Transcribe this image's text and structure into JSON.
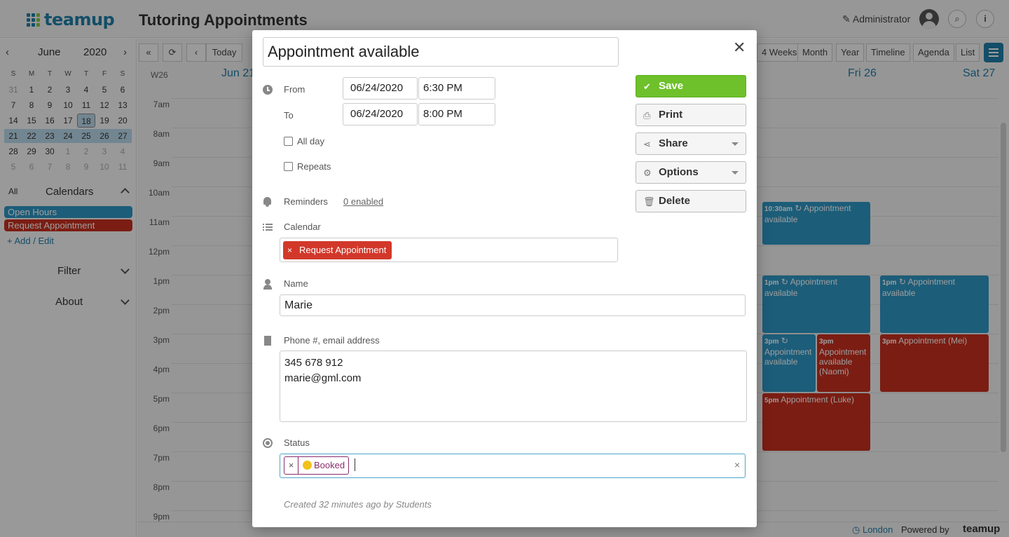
{
  "header": {
    "logo_text": "teamup",
    "title": "Tutoring Appointments",
    "user": "Administrator",
    "search_icon": "search-icon",
    "info_icon": "info-icon"
  },
  "mini_calendar": {
    "month": "June",
    "year": "2020",
    "prev_icon": "chevron-left-icon",
    "next_icon": "chevron-right-icon",
    "weekdays": [
      "S",
      "M",
      "T",
      "W",
      "T",
      "F",
      "S"
    ],
    "weeks": [
      [
        "31",
        "1",
        "2",
        "3",
        "4",
        "5",
        "6"
      ],
      [
        "7",
        "8",
        "9",
        "10",
        "11",
        "12",
        "13"
      ],
      [
        "14",
        "15",
        "16",
        "17",
        "18",
        "19",
        "20"
      ],
      [
        "21",
        "22",
        "23",
        "24",
        "25",
        "26",
        "27"
      ],
      [
        "28",
        "29",
        "30",
        "1",
        "2",
        "3",
        "4"
      ],
      [
        "5",
        "6",
        "7",
        "8",
        "9",
        "10",
        "11"
      ]
    ],
    "today": "18"
  },
  "sidebar": {
    "all_label": "All",
    "calendars_label": "Calendars",
    "calendars": [
      {
        "name": "Open Hours",
        "color": "#2e97c4"
      },
      {
        "name": "Request Appointment",
        "color": "#c7301f"
      }
    ],
    "add_edit": "+ Add / Edit",
    "filter_label": "Filter",
    "about_label": "About"
  },
  "toolbar": {
    "today": "Today",
    "views": [
      "4 Weeks",
      "Month",
      "Year",
      "Timeline",
      "Agenda",
      "List"
    ]
  },
  "calendar_grid": {
    "week_label": "W26",
    "day_headers": [
      "Jun 21",
      "Fri 26",
      "Sat 27"
    ],
    "hours": [
      "7am",
      "8am",
      "9am",
      "10am",
      "11am",
      "12pm",
      "1pm",
      "2pm",
      "3pm",
      "4pm",
      "5pm",
      "6pm",
      "7pm",
      "8pm",
      "9pm"
    ],
    "events": [
      {
        "time": "10:30am",
        "title": "Appointment available",
        "kind": "blue"
      },
      {
        "time": "1pm",
        "title": "Appointment available",
        "kind": "blue"
      },
      {
        "time": "1pm",
        "title": "Appointment available",
        "kind": "blue"
      },
      {
        "time": "3pm",
        "title": "Appointment available",
        "kind": "blue"
      },
      {
        "time": "3pm",
        "title": "Appointment available (Naomi)",
        "kind": "red"
      },
      {
        "time": "3pm",
        "title": "Appointment (Mei)",
        "kind": "red"
      },
      {
        "time": "5pm",
        "title": "Appointment (Luke)",
        "kind": "red"
      }
    ]
  },
  "footer": {
    "timezone": "London",
    "powered_by": "Powered by",
    "brand": "teamup"
  },
  "modal": {
    "title_value": "Appointment available",
    "from_label": "From",
    "to_label": "To",
    "from_date": "06/24/2020",
    "from_time": "6:30 PM",
    "to_date": "06/24/2020",
    "to_time": "8:00 PM",
    "all_day_label": "All day",
    "repeats_label": "Repeats",
    "reminders_label": "Reminders",
    "reminders_value": "0 enabled",
    "calendar_label": "Calendar",
    "calendar_tag": "Request Appointment",
    "name_label": "Name",
    "name_value": "Marie",
    "contact_label": "Phone #, email address",
    "contact_line1": "345 678 912",
    "contact_line2": "marie@gml.com",
    "status_label": "Status",
    "status_tag": "Booked",
    "created_note": "Created 32 minutes ago by Students",
    "buttons": {
      "save": "Save",
      "print": "Print",
      "share": "Share",
      "options": "Options",
      "delete": "Delete"
    },
    "colors": {
      "save": "#6ec12a",
      "calendar_tag": "#d2382a",
      "status_tag": "#8a2c6c"
    }
  }
}
